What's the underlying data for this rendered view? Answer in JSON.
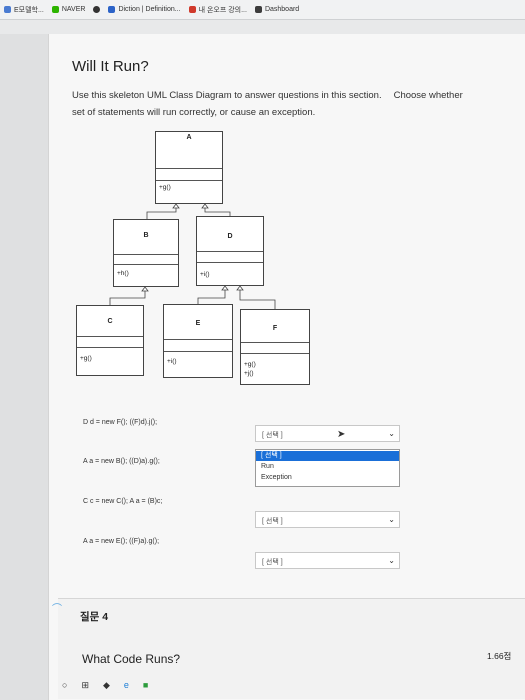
{
  "browser": {
    "tabs": [
      {
        "label": "E모델학...",
        "color": "#4a7bd1"
      },
      {
        "label": "NAVER",
        "color": "#2db400"
      },
      {
        "label": "",
        "color": "#333333"
      },
      {
        "label": "Diction | Definition...",
        "color": "#2c63c8"
      },
      {
        "label": "내 온오프 강의...",
        "color": "#d0392b"
      },
      {
        "label": "Dashboard",
        "color": "#3c3c3c"
      }
    ]
  },
  "section": {
    "title": "Will It Run?",
    "instructions_line1": "Use this skeleton UML Class Diagram to answer questions in this section.",
    "instructions_cont": "Choose whether",
    "instructions_line2": "set of statements will run correctly, or cause an exception."
  },
  "diagram": {
    "classes": [
      {
        "name": "A",
        "method": "+g()"
      },
      {
        "name": "B",
        "method": "+h()"
      },
      {
        "name": "D",
        "method": "+i()"
      },
      {
        "name": "C",
        "method": "+g()"
      },
      {
        "name": "E",
        "method": "+i()"
      },
      {
        "name": "F",
        "method": "+g()",
        "method2": "+j()"
      }
    ]
  },
  "statements": [
    {
      "code": "D d = new F(); ((F)d).j();",
      "selected": "[ 선택 ]"
    },
    {
      "code": "A a = new B(); ((D)a).g();",
      "selected": ""
    },
    {
      "code": "C c = new C(); A a = (B)c;",
      "selected": "[ 선택 ]"
    },
    {
      "code": "A a = new E(); ((F)a).g();",
      "selected": "[ 선택 ]"
    }
  ],
  "dropdown": {
    "options": [
      "[ 선택 ]",
      "Run",
      "Exception"
    ],
    "highlighted": "[ 선택 ]"
  },
  "next_question": {
    "number": "질문 4",
    "points": "1.66점",
    "text": "What Code Runs?"
  }
}
